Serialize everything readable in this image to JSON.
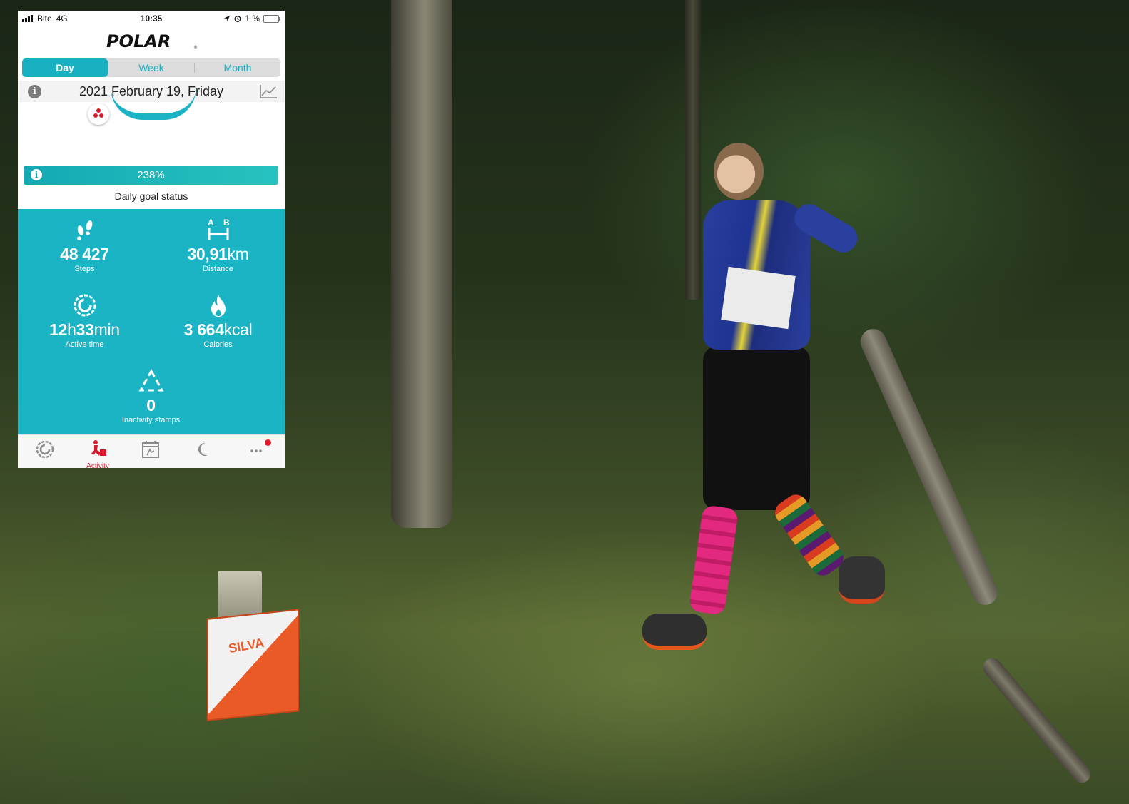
{
  "status_bar": {
    "carrier": "Bite",
    "network": "4G",
    "time": "10:35",
    "battery": "1 %"
  },
  "header": {
    "logo": "POLAR"
  },
  "tabs": [
    {
      "label": "Day",
      "active": true
    },
    {
      "label": "Week",
      "active": false
    },
    {
      "label": "Month",
      "active": false
    }
  ],
  "date_row": {
    "date": "2021 February 19, Friday",
    "info_icon": "info-icon",
    "trend_icon": "trend-chart-icon"
  },
  "goal": {
    "percent": "238%",
    "label": "Daily goal status"
  },
  "stats": {
    "steps": {
      "value": "48 427",
      "unit": "",
      "label": "Steps",
      "icon": "footsteps-icon"
    },
    "distance": {
      "value": "30,91",
      "unit": "km",
      "label": "Distance",
      "icon": "distance-icon"
    },
    "active_time": {
      "value_h": "12",
      "unit_h": "h",
      "value_m": "33",
      "unit_m": "min",
      "label": "Active time",
      "icon": "activity-ring-icon"
    },
    "calories": {
      "value": "3 664",
      "unit": "kcal",
      "label": "Calories",
      "icon": "flame-icon"
    },
    "inactivity": {
      "value": "0",
      "label": "Inactivity stamps",
      "icon": "inactivity-icon"
    }
  },
  "bottom_nav": [
    {
      "name": "status",
      "icon": "activity-ring-icon",
      "label": ""
    },
    {
      "name": "activity",
      "icon": "activity-runner-icon",
      "label": "Activity",
      "active": true
    },
    {
      "name": "diary",
      "icon": "calendar-diary-icon",
      "label": ""
    },
    {
      "name": "sleep",
      "icon": "moon-icon",
      "label": ""
    },
    {
      "name": "more",
      "icon": "more-icon",
      "label": "",
      "notification": true
    }
  ],
  "photo": {
    "control_flag_text": "SILVA",
    "colors": {
      "flag_orange": "#ea5a26",
      "sock_pink": "#e2287f",
      "jersey_blue": "#2a3f9e"
    }
  },
  "colors": {
    "accent_teal": "#1ab4c4",
    "polar_red": "#d7192d"
  }
}
